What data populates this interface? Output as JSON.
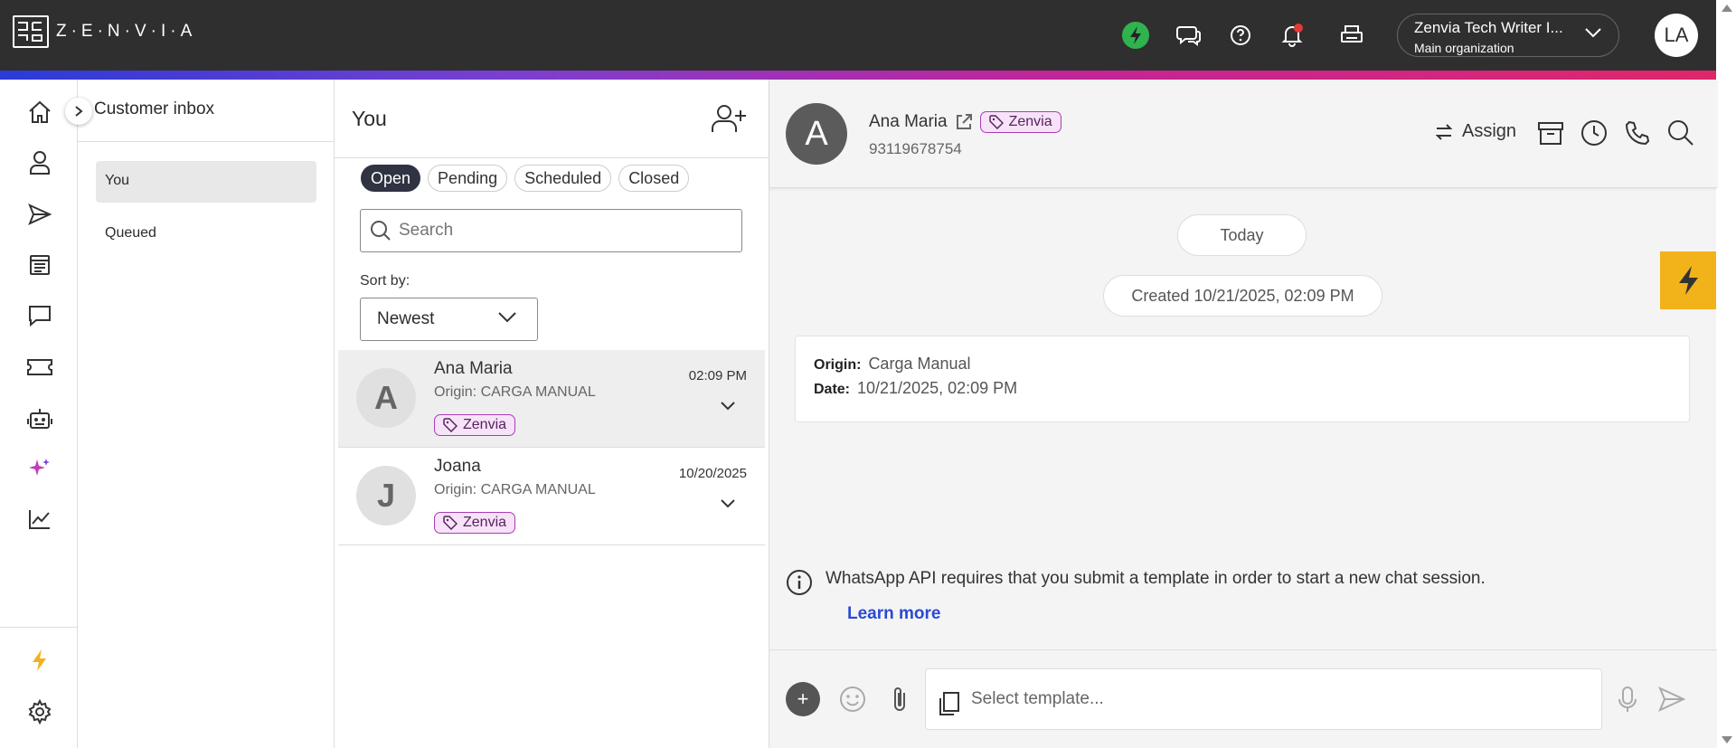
{
  "brand": {
    "logo_text": "Z·E·N·V·I·A"
  },
  "topbar": {
    "org_name": "Zenvia Tech Writer I...",
    "org_sub": "Main organization",
    "user_initials": "LA",
    "colors": {
      "bolt_bg": "#2fb34f",
      "notification_dot": "#e53935"
    }
  },
  "sidebar": {
    "items": [
      {
        "icon": "home-icon"
      },
      {
        "icon": "contact-icon"
      },
      {
        "icon": "send-icon"
      },
      {
        "icon": "document-icon"
      },
      {
        "icon": "chat-icon"
      },
      {
        "icon": "ticket-icon"
      },
      {
        "icon": "bot-icon"
      },
      {
        "icon": "sparkle-icon"
      },
      {
        "icon": "analytics-icon"
      },
      {
        "icon": "bolt-icon"
      },
      {
        "icon": "settings-icon"
      }
    ]
  },
  "inbox": {
    "title": "Customer inbox",
    "items": [
      {
        "label": "You",
        "active": true
      },
      {
        "label": "Queued",
        "active": false
      }
    ]
  },
  "list": {
    "title": "You",
    "filters": [
      {
        "label": "Open",
        "active": true
      },
      {
        "label": "Pending",
        "active": false
      },
      {
        "label": "Scheduled",
        "active": false
      },
      {
        "label": "Closed",
        "active": false
      }
    ],
    "search_placeholder": "Search",
    "sort_label": "Sort by:",
    "sort_value": "Newest",
    "conversations": [
      {
        "initial": "A",
        "name": "Ana Maria",
        "origin": "Origin: CARGA MANUAL",
        "time": "02:09 PM",
        "tag": "Zenvia"
      },
      {
        "initial": "J",
        "name": "Joana",
        "origin": "Origin: CARGA MANUAL",
        "time": "10/20/2025",
        "tag": "Zenvia"
      }
    ]
  },
  "chat": {
    "initial": "A",
    "name": "Ana Maria",
    "tag": "Zenvia",
    "phone": "93119678754",
    "assign_label": "Assign",
    "date_pill": "Today",
    "created_pill": "Created 10/21/2025, 02:09 PM",
    "info": {
      "origin_label": "Origin:",
      "origin_value": "Carga Manual",
      "date_label": "Date:",
      "date_value": "10/21/2025, 02:09 PM"
    },
    "notice": "WhatsApp API requires that you submit a template in order to start a new chat session.",
    "learn_more": "Learn more",
    "template_placeholder": "Select template...",
    "plus_label": "+"
  }
}
